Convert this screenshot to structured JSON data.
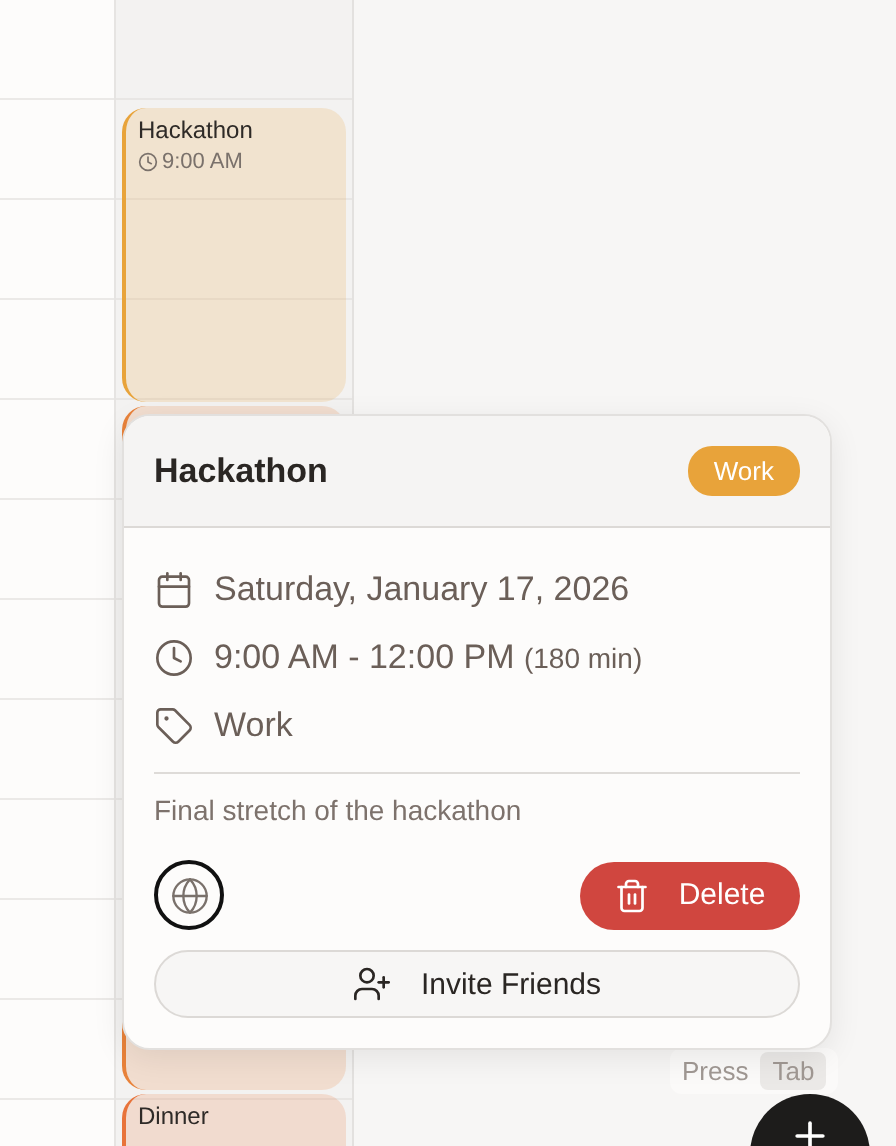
{
  "calendar": {
    "events": [
      {
        "title": "Hackathon",
        "time": "9:00 AM",
        "color": "#e8a33a"
      },
      {
        "color": "#e8823a"
      },
      {
        "title": "Dinner",
        "color": "#e8733a"
      }
    ]
  },
  "popup": {
    "title": "Hackathon",
    "badge": "Work",
    "date": "Saturday, January 17, 2026",
    "time": "9:00 AM - 12:00 PM",
    "duration": "(180 min)",
    "tag": "Work",
    "description": "Final stretch of the hackathon",
    "delete_label": "Delete",
    "invite_label": "Invite Friends"
  },
  "hint": {
    "word": "Press",
    "key": "Tab"
  }
}
